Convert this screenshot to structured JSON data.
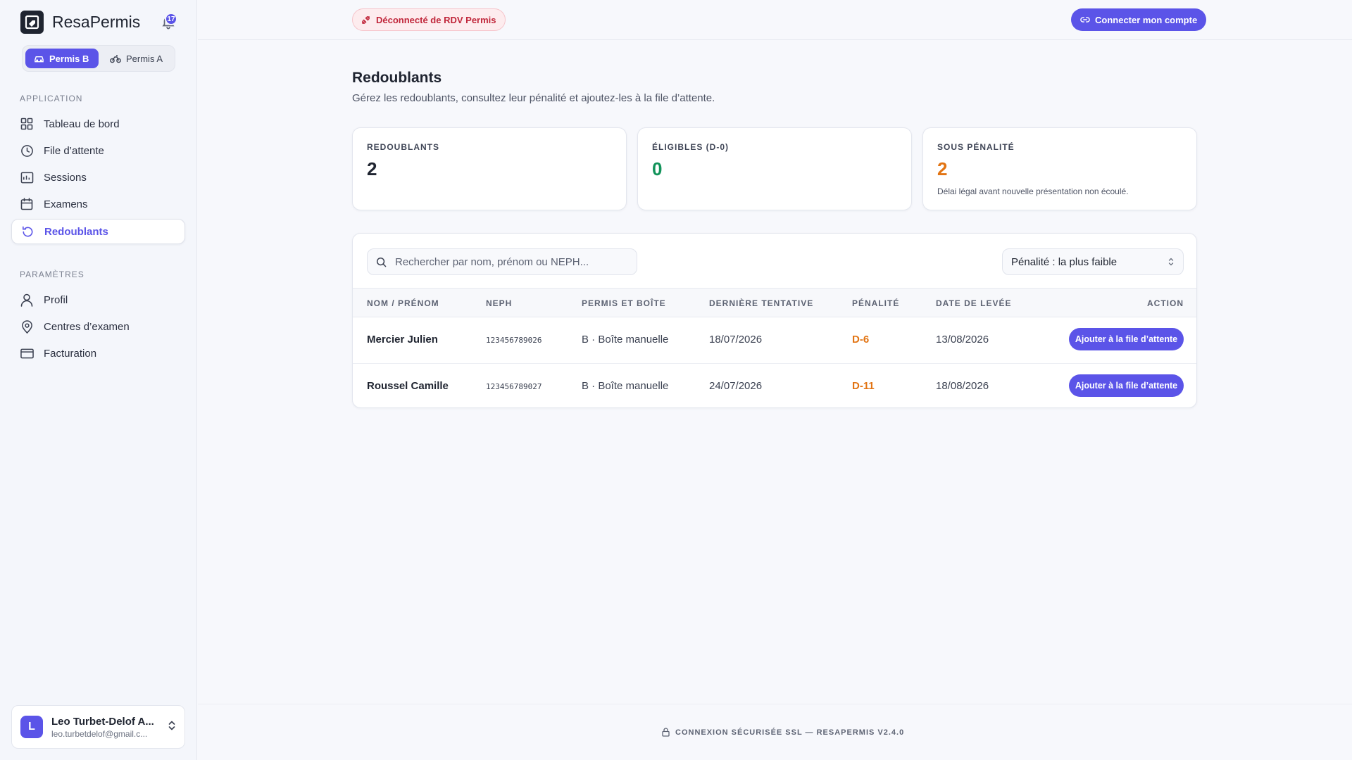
{
  "brand": {
    "name": "ResaPermis",
    "notifications": "17"
  },
  "permis_toggle": {
    "options": [
      "Permis B",
      "Permis A"
    ],
    "active": "Permis B"
  },
  "sidebar": {
    "application_title": "APPLICATION",
    "application_items": [
      {
        "label": "Tableau de bord",
        "icon": "grid-icon"
      },
      {
        "label": "File d’attente",
        "icon": "clock-icon"
      },
      {
        "label": "Sessions",
        "icon": "sessions-icon"
      },
      {
        "label": "Examens",
        "icon": "calendar-icon"
      },
      {
        "label": "Redoublants",
        "icon": "rotate-icon",
        "active": true
      }
    ],
    "settings_title": "PARAMÈTRES",
    "settings_items": [
      {
        "label": "Profil",
        "icon": "user-icon"
      },
      {
        "label": "Centres d’examen",
        "icon": "map-pin-icon"
      },
      {
        "label": "Facturation",
        "icon": "credit-card-icon"
      }
    ]
  },
  "user": {
    "initial": "L",
    "name": "Leo Turbet-Delof A...",
    "email": "leo.turbetdelof@gmail.c..."
  },
  "topbar": {
    "status": "Déconnecté de RDV Permis",
    "connect_label": "Connecter mon compte"
  },
  "page": {
    "title": "Redoublants",
    "subtitle": "Gérez les redoublants, consultez leur pénalité et ajoutez-les à la file d’attente."
  },
  "stats": [
    {
      "label": "REDOUBLANTS",
      "value": "2",
      "color": "#1f2430",
      "note": ""
    },
    {
      "label": "ÉLIGIBLES (D-0)",
      "value": "0",
      "color": "#12935a",
      "note": ""
    },
    {
      "label": "SOUS PÉNALITÉ",
      "value": "2",
      "color": "#e27413",
      "note": "Délai légal avant nouvelle présentation non écoulé."
    }
  ],
  "search": {
    "placeholder": "Rechercher par nom, prénom ou NEPH..."
  },
  "sort": {
    "selected": "Pénalité : la plus faible"
  },
  "table": {
    "headers": [
      "NOM / PRÉNOM",
      "NEPH",
      "PERMIS ET BOÎTE",
      "DERNIÈRE TENTATIVE",
      "PÉNALITÉ",
      "DATE DE LEVÉE",
      "ACTION"
    ],
    "rows": [
      {
        "name": "Mercier Julien",
        "neph": "123456789026",
        "permis": "B · Boîte manuelle",
        "last": "18/07/2026",
        "penalty": "D-6",
        "lift": "13/08/2026",
        "action": "Ajouter à la file d’attente"
      },
      {
        "name": "Roussel Camille",
        "neph": "123456789027",
        "permis": "B · Boîte manuelle",
        "last": "24/07/2026",
        "penalty": "D-11",
        "lift": "18/08/2026",
        "action": "Ajouter à la file d’attente"
      }
    ]
  },
  "footer": {
    "text": "CONNEXION SÉCURISÉE SSL — RESAPERMIS V2.4.0"
  },
  "colors": {
    "accent": "#5b54e8",
    "danger": "#c0263a",
    "warning": "#e27413",
    "success": "#12935a"
  }
}
